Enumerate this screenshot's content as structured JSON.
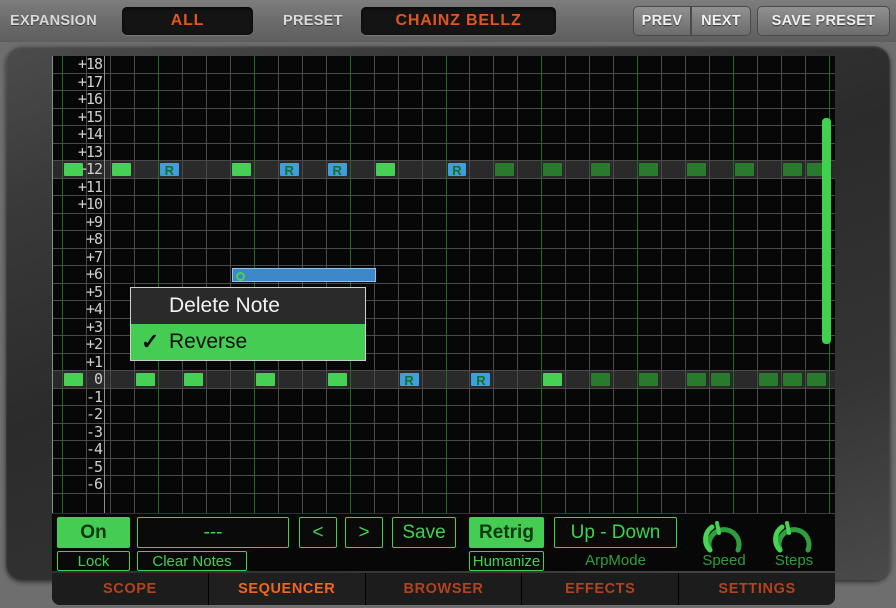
{
  "toolbar": {
    "expansion_label": "EXPANSION",
    "expansion_value": "ALL",
    "preset_label": "PRESET",
    "preset_value": "CHAINZ BELLZ",
    "prev_label": "PREV",
    "next_label": "NEXT",
    "save_preset_label": "SAVE PRESET",
    "accent_color": "#e0561f"
  },
  "grid": {
    "row_labels": [
      "+18",
      "+17",
      "+16",
      "+15",
      "+14",
      "+13",
      "+12",
      "+11",
      "+10",
      "+9",
      "+8",
      "+7",
      "+6",
      "+5",
      "+4",
      "+3",
      "+2",
      "+1",
      "0",
      "-1",
      "-2",
      "-3",
      "-4",
      "-5",
      "-6"
    ],
    "highlight_rows": [
      "+12",
      "0"
    ],
    "columns": 32,
    "beat_every": 4,
    "reverse_marker": "R",
    "note_color_active": "#44d154",
    "note_color_dim": "#2a7a2e",
    "note_color_reversed": "#3e9fe0",
    "selected_note_color": "#3e87c8"
  },
  "notes_row_plus12": [
    {
      "step": 0,
      "type": "green"
    },
    {
      "step": 2,
      "type": "green"
    },
    {
      "step": 4,
      "type": "blue"
    },
    {
      "step": 7,
      "type": "green"
    },
    {
      "step": 9,
      "type": "blue"
    },
    {
      "step": 11,
      "type": "blue"
    },
    {
      "step": 13,
      "type": "green"
    },
    {
      "step": 16,
      "type": "blue"
    },
    {
      "step": 18,
      "type": "dim"
    },
    {
      "step": 20,
      "type": "dim"
    },
    {
      "step": 22,
      "type": "dim"
    },
    {
      "step": 24,
      "type": "dim"
    },
    {
      "step": 26,
      "type": "dim"
    },
    {
      "step": 28,
      "type": "dim"
    },
    {
      "step": 30,
      "type": "dim"
    },
    {
      "step": 31,
      "type": "dim"
    }
  ],
  "notes_row_zero": [
    {
      "step": 0,
      "type": "green"
    },
    {
      "step": 3,
      "type": "green"
    },
    {
      "step": 5,
      "type": "green"
    },
    {
      "step": 8,
      "type": "green"
    },
    {
      "step": 11,
      "type": "green"
    },
    {
      "step": 14,
      "type": "blue"
    },
    {
      "step": 17,
      "type": "blue"
    },
    {
      "step": 20,
      "type": "green"
    },
    {
      "step": 22,
      "type": "dim"
    },
    {
      "step": 24,
      "type": "dim"
    },
    {
      "step": 26,
      "type": "dim"
    },
    {
      "step": 27,
      "type": "dim"
    },
    {
      "step": 29,
      "type": "dim"
    },
    {
      "step": 30,
      "type": "dim"
    },
    {
      "step": 31,
      "type": "dim"
    }
  ],
  "selected_note": {
    "row_label": "+6",
    "start_step": 7,
    "length_steps": 6
  },
  "context_menu": {
    "items": [
      {
        "label": "Delete Note",
        "checked": false,
        "selected": false
      },
      {
        "label": "Reverse",
        "checked": true,
        "selected": true
      }
    ],
    "check_glyph": "✓"
  },
  "controls": {
    "power_label": "On",
    "lock_label": "Lock",
    "pattern_value": "---",
    "clear_notes_label": "Clear Notes",
    "prev_pattern_label": "<",
    "next_pattern_label": ">",
    "save_label": "Save",
    "retrig_label": "Retrig",
    "humanize_label": "Humanize",
    "arpmode_value": "Up - Down",
    "arpmode_label": "ArpMode",
    "speed_label": "Speed",
    "steps_label": "Steps"
  },
  "tabs": [
    {
      "label": "SCOPE",
      "active": false
    },
    {
      "label": "SEQUENCER",
      "active": true
    },
    {
      "label": "BROWSER",
      "active": false
    },
    {
      "label": "EFFECTS",
      "active": false
    },
    {
      "label": "SETTINGS",
      "active": false
    }
  ]
}
